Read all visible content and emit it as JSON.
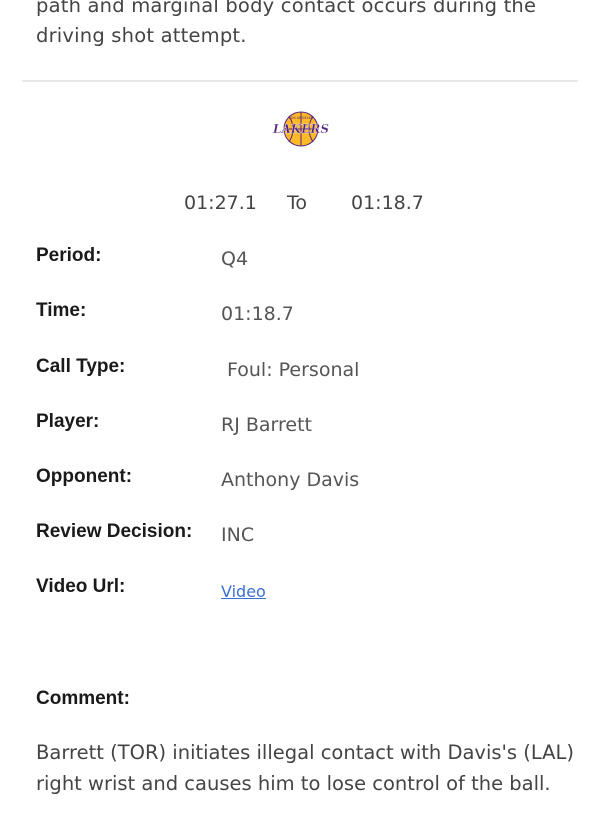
{
  "intro": {
    "text": "path and marginal body contact occurs during the driving shot attempt."
  },
  "logo": {
    "wordmark": "LAKERS",
    "subtext": "LOS ANGELES",
    "colors": {
      "purple": "#552583",
      "gold": "#FDB927"
    }
  },
  "time_range": {
    "start": "01:27.1",
    "to": "To",
    "end": "01:18.7"
  },
  "fields": {
    "period": {
      "label": "Period:",
      "value": "Q4"
    },
    "time": {
      "label": "Time:",
      "value": "01:18.7"
    },
    "call_type": {
      "label": "Call Type:",
      "value": "Foul: Personal"
    },
    "player": {
      "label": "Player:",
      "value": "RJ Barrett"
    },
    "opponent": {
      "label": "Opponent:",
      "value": "Anthony Davis"
    },
    "review_decision": {
      "label": "Review Decision:",
      "value": "INC"
    },
    "video_url": {
      "label": "Video Url:",
      "link_text": "Video"
    }
  },
  "comment": {
    "label": "Comment:",
    "text": "Barrett (TOR) initiates illegal contact with Davis's (LAL) right wrist and causes him to lose control of the ball."
  },
  "colors": {
    "link": "#3b6fd6",
    "divider": "#e8e8e8"
  }
}
